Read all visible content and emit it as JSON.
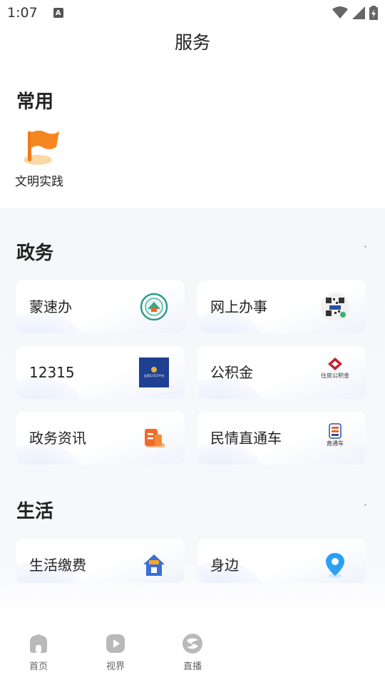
{
  "status_bar": {
    "time": "1:07",
    "notification_glyph": "A"
  },
  "header": {
    "title": "服务"
  },
  "common": {
    "title": "常用",
    "items": [
      {
        "label": "文明实践",
        "icon": "flag-icon"
      }
    ]
  },
  "government": {
    "title": "政务",
    "cards": [
      {
        "label": "蒙速办",
        "icon": "mengsuban-logo-icon"
      },
      {
        "label": "网上办事",
        "icon": "qr-code-icon"
      },
      {
        "label": "12315",
        "icon": "12315-logo-icon",
        "icon_text": "全国12315平台"
      },
      {
        "label": "公积金",
        "icon": "housing-fund-logo-icon",
        "icon_text": "住房公积金"
      },
      {
        "label": "政务资讯",
        "icon": "news-document-icon"
      },
      {
        "label": "民情直通车",
        "icon": "direct-train-icon",
        "icon_text": "直通车"
      }
    ]
  },
  "life": {
    "title": "生活",
    "cards": [
      {
        "label": "生活缴费",
        "icon": "house-payment-icon"
      },
      {
        "label": "身边",
        "icon": "location-pin-icon"
      }
    ]
  },
  "bottom_nav": {
    "items": [
      {
        "label": "首页",
        "icon": "home-icon"
      },
      {
        "label": "视界",
        "icon": "play-video-icon"
      },
      {
        "label": "直播",
        "icon": "live-logo-icon"
      }
    ]
  },
  "colors": {
    "accent_orange": "#f5861f",
    "card_bg": "#ffffff",
    "section_bg": "#f5f7fb",
    "nav_icon": "#b9b9b9"
  }
}
